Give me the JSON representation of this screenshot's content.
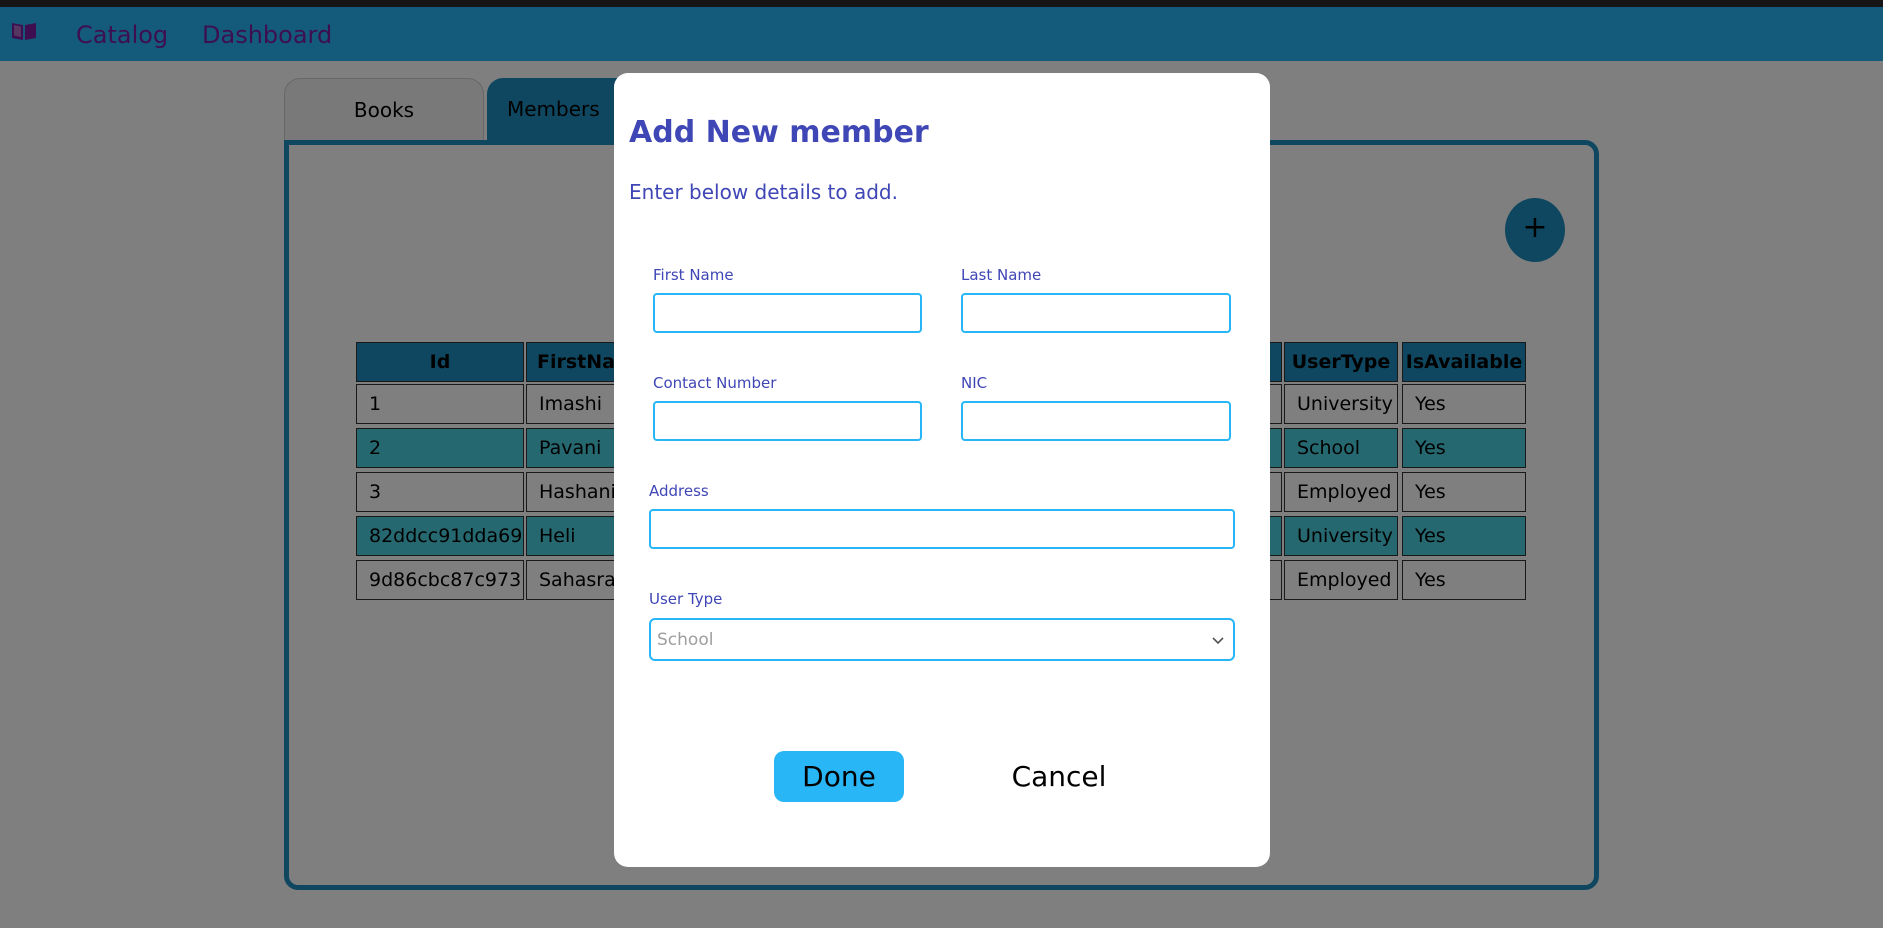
{
  "nav": {
    "brand_icon": "book-open-icon",
    "links": [
      {
        "label": "Catalog"
      },
      {
        "label": "Dashboard"
      }
    ]
  },
  "tabs": [
    {
      "label": "Books"
    },
    {
      "label": "Members"
    }
  ],
  "add_button": {
    "icon": "plus-icon",
    "label": "+"
  },
  "table": {
    "columns": [
      "Id",
      "FirstName",
      "UserType",
      "IsAvailable"
    ],
    "rows": [
      {
        "id": "1",
        "first_name": "Imashi",
        "user_type": "University",
        "is_available": "Yes"
      },
      {
        "id": "2",
        "first_name": "Pavani",
        "user_type": "School",
        "is_available": "Yes"
      },
      {
        "id": "3",
        "first_name": "Hashani",
        "user_type": "Employed",
        "is_available": "Yes"
      },
      {
        "id": "82ddcc91dda69",
        "first_name": "Heli",
        "user_type": "University",
        "is_available": "Yes"
      },
      {
        "id": "9d86cbc87c973",
        "first_name": "Sahasra",
        "user_type": "Employed",
        "is_available": "Yes"
      }
    ]
  },
  "modal": {
    "title": "Add New member",
    "subtitle": "Enter below details to add.",
    "fields": {
      "first_name": {
        "label": "First Name",
        "value": ""
      },
      "last_name": {
        "label": "Last Name",
        "value": ""
      },
      "contact_number": {
        "label": "Contact Number",
        "value": ""
      },
      "nic": {
        "label": "NIC",
        "value": ""
      },
      "address": {
        "label": "Address",
        "value": ""
      },
      "user_type": {
        "label": "User Type",
        "selected": "School"
      }
    },
    "done_label": "Done",
    "cancel_label": "Cancel"
  },
  "colors": {
    "navbar": "#29b6f6",
    "nav_link": "#7b1fa2",
    "accent": "#1e8fc0",
    "row_highlight": "#4dd0e1",
    "modal_text": "#3f46b5"
  }
}
